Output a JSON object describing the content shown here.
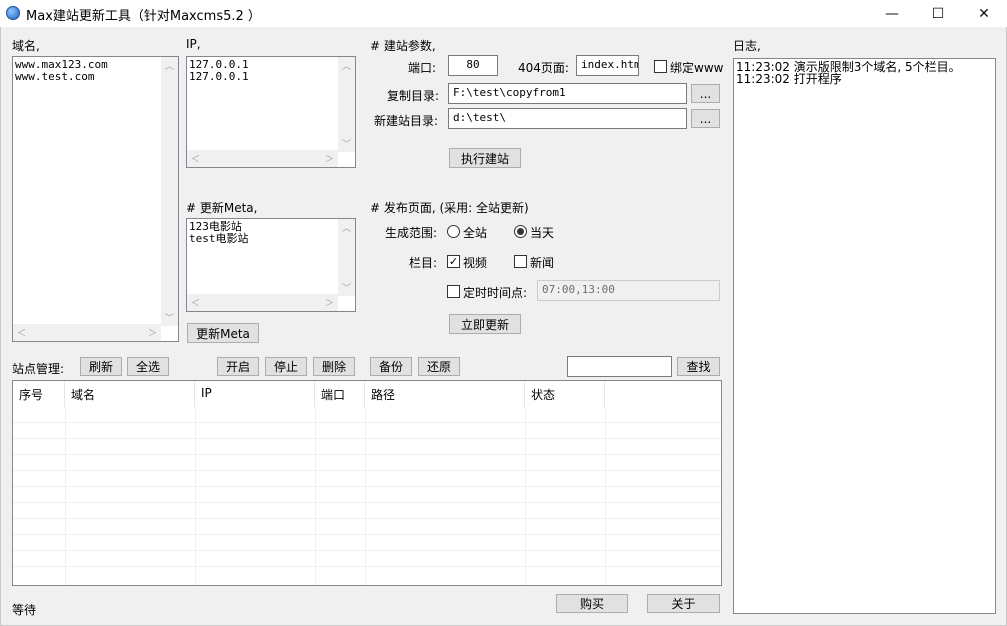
{
  "window": {
    "title": "Max建站更新工具（针对Maxcms5.2 ）",
    "minimize": "—",
    "maximize": "☐",
    "close": "✕"
  },
  "domains": {
    "label": "域名,",
    "items": [
      "www.max123.com",
      "www.test.com"
    ]
  },
  "ip": {
    "label": "IP,",
    "items": [
      "127.0.0.1",
      "127.0.0.1"
    ]
  },
  "meta": {
    "label": "# 更新Meta,",
    "items": [
      "123电影站",
      "test电影站"
    ],
    "button": "更新Meta"
  },
  "build": {
    "section_label": "# 建站参数,",
    "port_label": "端口:",
    "port_value": "80",
    "page404_label": "404页面:",
    "page404_value": "index.htm",
    "bind_www_label": "绑定www",
    "bind_www_checked": false,
    "copy_dir_label": "复制目录:",
    "copy_dir_value": "F:\\test\\copyfrom1",
    "new_dir_label": "新建站目录:",
    "new_dir_value": "d:\\test\\",
    "browse_label": "...",
    "execute_button": "执行建站"
  },
  "publish": {
    "section_label": "# 发布页面, (采用: 全站更新)",
    "range_label": "生成范围:",
    "range_options": [
      "全站",
      "当天"
    ],
    "range_selected": "当天",
    "columns_label": "栏目:",
    "column_video": "视频",
    "column_video_checked": true,
    "column_news": "新闻",
    "column_news_checked": false,
    "timed_label": "定时时间点:",
    "timed_checked": false,
    "timed_value": "07:00,13:00",
    "update_button": "立即更新"
  },
  "log": {
    "label": "日志,",
    "entries": [
      "11:23:02 演示版限制3个域名, 5个栏目。",
      "11:23:02 打开程序"
    ]
  },
  "site_manage": {
    "label": "站点管理:",
    "refresh": "刷新",
    "select_all": "全选",
    "start": "开启",
    "stop": "停止",
    "delete": "删除",
    "backup": "备份",
    "restore": "还原",
    "search_value": "",
    "search_button": "查找",
    "columns": [
      "序号",
      "域名",
      "IP",
      "端口",
      "路径",
      "状态"
    ]
  },
  "footer": {
    "status": "等待",
    "buy": "购买",
    "about": "关于"
  },
  "colors": {
    "window_bg": "#f0f0f0",
    "button_bg": "#e1e1e1",
    "button_border": "#adadad"
  }
}
